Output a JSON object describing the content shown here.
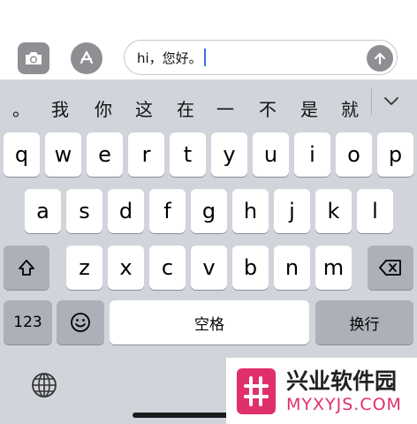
{
  "composer": {
    "input_value": "hi，您好。",
    "camera_icon": "camera-icon",
    "appstore_icon": "app-store-icon",
    "send_icon": "arrow-up-icon"
  },
  "candidates": [
    "。",
    "我",
    "你",
    "这",
    "在",
    "一",
    "不",
    "是",
    "就"
  ],
  "keyboard": {
    "row1": [
      "q",
      "w",
      "e",
      "r",
      "t",
      "y",
      "u",
      "i",
      "o",
      "p"
    ],
    "row2": [
      "a",
      "s",
      "d",
      "f",
      "g",
      "h",
      "j",
      "k",
      "l"
    ],
    "row3": [
      "z",
      "x",
      "c",
      "v",
      "b",
      "n",
      "m"
    ],
    "shift_icon": "shift-icon",
    "delete_icon": "delete-icon",
    "numbers_label": "123",
    "emoji_icon": "emoji-icon",
    "space_label": "空格",
    "return_label": "换行",
    "globe_icon": "globe-icon"
  },
  "watermark": {
    "title": "兴业软件园",
    "subtitle": "MYXYJS.COM"
  },
  "colors": {
    "keyboard_bg": "#d2d4dc",
    "key_bg": "#ffffff",
    "fn_key_bg": "#adb0b8",
    "caret": "#3a6fe0",
    "brand": "#e0306a"
  }
}
